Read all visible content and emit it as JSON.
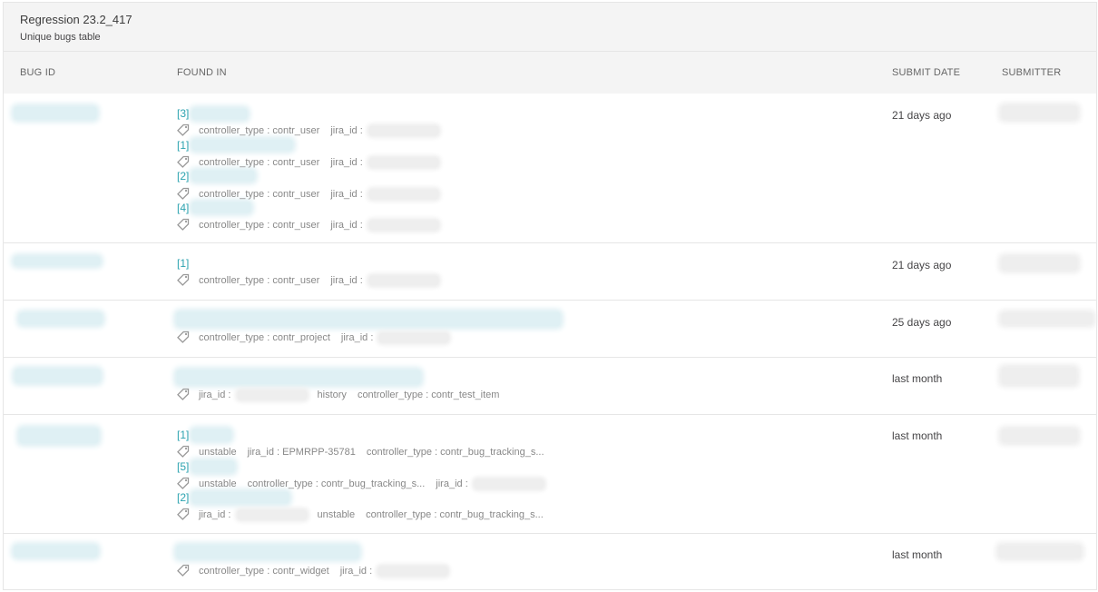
{
  "widget": {
    "title": "Regression 23.2_417",
    "subtitle": "Unique bugs table"
  },
  "columns": {
    "bug_id": "BUG ID",
    "found_in": "FOUND IN",
    "submit_date": "SUBMIT DATE",
    "submitter": "SUBMITTER"
  },
  "rows": [
    {
      "submit_date": "21 days ago",
      "items": [
        {
          "index": "[3]",
          "attrs": [
            {
              "key": "controller_type",
              "value": "contr_user"
            },
            {
              "key": "jira_id",
              "value": ""
            }
          ]
        },
        {
          "index": "[1]",
          "attrs": [
            {
              "key": "controller_type",
              "value": "contr_user"
            },
            {
              "key": "jira_id",
              "value": ""
            }
          ]
        },
        {
          "index": "[2]",
          "attrs": [
            {
              "key": "controller_type",
              "value": "contr_user"
            },
            {
              "key": "jira_id",
              "value": ""
            }
          ]
        },
        {
          "index": "[4]",
          "attrs": [
            {
              "key": "controller_type",
              "value": "contr_user"
            },
            {
              "key": "jira_id",
              "value": ""
            }
          ]
        }
      ]
    },
    {
      "submit_date": "21 days ago",
      "items": [
        {
          "index": "[1]",
          "attrs": [
            {
              "key": "controller_type",
              "value": "contr_user"
            },
            {
              "key": "jira_id",
              "value": ""
            }
          ]
        }
      ]
    },
    {
      "submit_date": "25 days ago",
      "items": [
        {
          "index": "",
          "attrs": [
            {
              "key": "controller_type",
              "value": "contr_project"
            },
            {
              "key": "jira_id",
              "value": ""
            }
          ]
        }
      ]
    },
    {
      "submit_date": "last month",
      "items": [
        {
          "index": "",
          "attrs": [
            {
              "key": "jira_id",
              "value": ""
            },
            {
              "key": "history",
              "value": null
            },
            {
              "key": "controller_type",
              "value": "contr_test_item"
            }
          ]
        }
      ]
    },
    {
      "submit_date": "last month",
      "items": [
        {
          "index": "[1]",
          "attrs": [
            {
              "key": "unstable",
              "value": null
            },
            {
              "key": "jira_id",
              "value": "EPMRPP-35781"
            },
            {
              "key": "controller_type",
              "value": "contr_bug_tracking_s..."
            }
          ]
        },
        {
          "index": "[5]",
          "attrs": [
            {
              "key": "unstable",
              "value": null
            },
            {
              "key": "controller_type",
              "value": "contr_bug_tracking_s..."
            },
            {
              "key": "jira_id",
              "value": ""
            }
          ]
        },
        {
          "index": "[2]",
          "attrs": [
            {
              "key": "jira_id",
              "value": ""
            },
            {
              "key": "unstable",
              "value": null
            },
            {
              "key": "controller_type",
              "value": "contr_bug_tracking_s..."
            }
          ]
        }
      ]
    },
    {
      "submit_date": "last month",
      "items": [
        {
          "index": "",
          "attrs": [
            {
              "key": "controller_type",
              "value": "contr_widget"
            },
            {
              "key": "jira_id",
              "value": ""
            }
          ]
        }
      ]
    }
  ]
}
